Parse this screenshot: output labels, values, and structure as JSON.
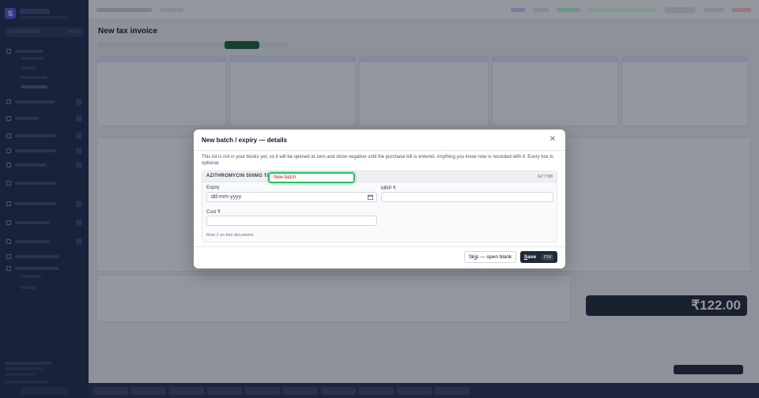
{
  "modal": {
    "title": "New batch / expiry — details",
    "description": "This lot is not in your books yet, so it will be opened at zero and show negative until the purchase bill is entered. Anything you know now is recorded with it. Every box is optional.",
    "product_name": "AZITHROMYCIN 500MG TA",
    "batch_placeholder": "New batch",
    "product_code": "AZ7788",
    "expiry_label": "Expiry",
    "expiry_placeholder": "dd-mm-yyyy",
    "mrp_label": "MRP ₹",
    "cost_label": "Cost ₹",
    "row_info": "Row 1 on this document.",
    "skip_prefix": "Sk",
    "skip_underline": "i",
    "skip_suffix": "p — open blank",
    "save_prefix": "",
    "save_underline": "S",
    "save_suffix": "ave",
    "save_kbd": "F10"
  },
  "icons": {
    "close": "close-icon",
    "calendar": "calendar-icon"
  },
  "background": {
    "page_title": "New tax invoice",
    "total_amount": "₹122.00"
  },
  "colors": {
    "accent": "#22c55e",
    "sidebar": "#1e2a4a",
    "primary_button": "#1f2937"
  }
}
